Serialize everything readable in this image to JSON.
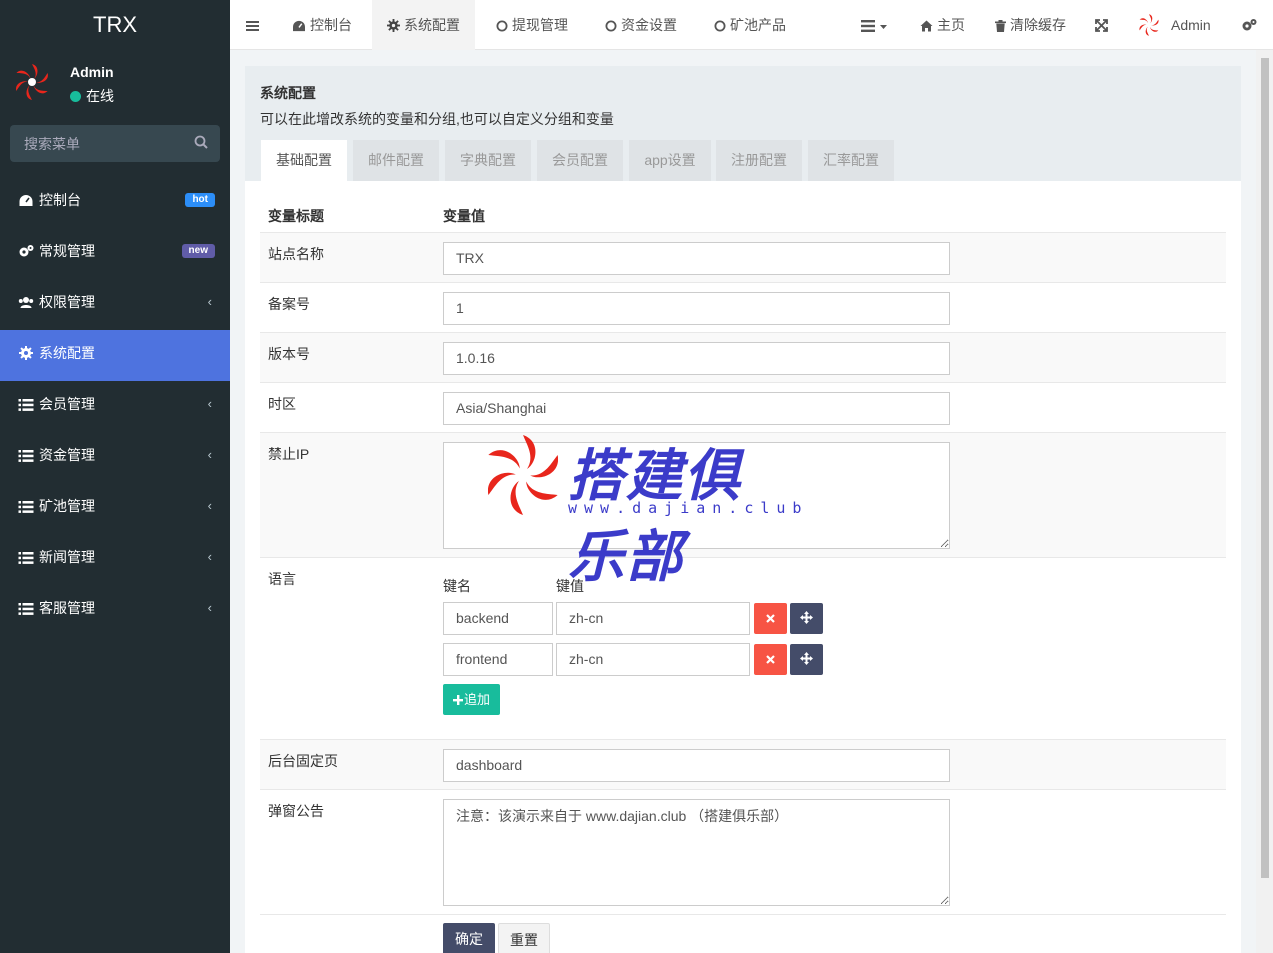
{
  "app": {
    "logo_text": "TRX",
    "user": {
      "name": "Admin",
      "status": "在线"
    },
    "search_placeholder": "搜索菜单"
  },
  "sidebar": {
    "items": [
      {
        "label": "控制台",
        "icon": "dashboard-icon",
        "badge": "hot"
      },
      {
        "label": "常规管理",
        "icon": "cogs-icon",
        "badge": "new"
      },
      {
        "label": "权限管理",
        "icon": "group-icon",
        "chevron": true
      },
      {
        "label": "系统配置",
        "icon": "gear-icon",
        "active": true
      },
      {
        "label": "会员管理",
        "icon": "list-icon",
        "chevron": true
      },
      {
        "label": "资金管理",
        "icon": "list-icon",
        "chevron": true
      },
      {
        "label": "矿池管理",
        "icon": "list-icon",
        "chevron": true
      },
      {
        "label": "新闻管理",
        "icon": "list-icon",
        "chevron": true
      },
      {
        "label": "客服管理",
        "icon": "list-icon",
        "chevron": true
      }
    ]
  },
  "header": {
    "tabs": [
      {
        "label": "控制台"
      },
      {
        "label": "系统配置"
      },
      {
        "label": "提现管理"
      },
      {
        "label": "资金设置"
      },
      {
        "label": "矿池产品"
      }
    ],
    "home": "主页",
    "clear_cache": "清除缓存",
    "admin": "Admin"
  },
  "page": {
    "title": "系统配置",
    "description": "可以在此增改系统的变量和分组,也可以自定义分组和变量",
    "tabs": [
      "基础配置",
      "邮件配置",
      "字典配置",
      "会员配置",
      "app设置",
      "注册配置",
      "汇率配置"
    ],
    "table_headers": {
      "title": "变量标题",
      "value": "变量值"
    },
    "fields": {
      "site_name": {
        "label": "站点名称",
        "value": "TRX"
      },
      "beian": {
        "label": "备案号",
        "value": "1"
      },
      "version": {
        "label": "版本号",
        "value": "1.0.16"
      },
      "timezone": {
        "label": "时区",
        "value": "Asia/Shanghai"
      },
      "forbidden_ip": {
        "label": "禁止IP",
        "value": ""
      },
      "language": {
        "label": "语言",
        "key_header": "键名",
        "value_header": "键值",
        "rows": [
          {
            "key": "backend",
            "value": "zh-cn"
          },
          {
            "key": "frontend",
            "value": "zh-cn"
          }
        ],
        "add_label": "追加"
      },
      "fixed_page": {
        "label": "后台固定页",
        "value": "dashboard"
      },
      "popup_notice": {
        "label": "弹窗公告",
        "value": "注意：该演示来自于 www.dajian.club （搭建俱乐部）"
      }
    },
    "buttons": {
      "ok": "确定",
      "reset": "重置"
    }
  },
  "watermark": {
    "title": "搭建俱乐部",
    "url": "www.dajian.club"
  },
  "colors": {
    "sidebar_bg": "#222d32",
    "active": "#4e73df",
    "success": "#18bc9c",
    "danger": "#f75444",
    "primary_dark": "#444c69"
  }
}
